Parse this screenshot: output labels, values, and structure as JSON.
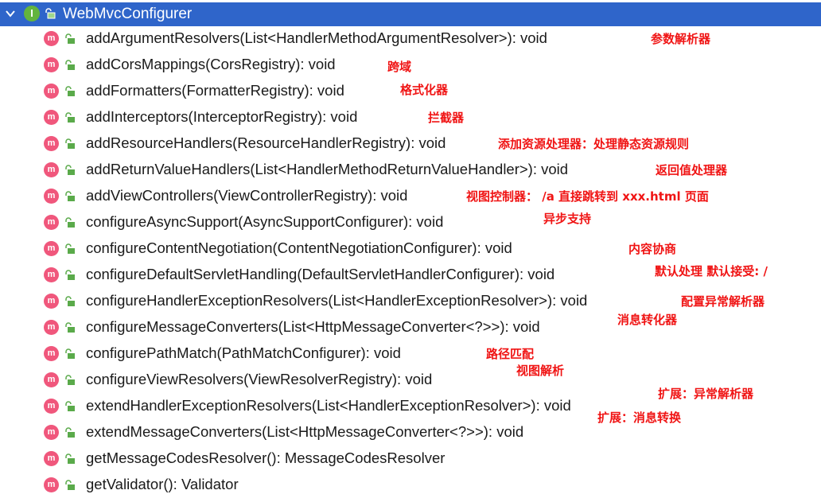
{
  "header": {
    "interface_icon_letter": "I",
    "title": "WebMvcConfigurer"
  },
  "method_icon_letter": "m",
  "methods": [
    {
      "signature": "addArgumentResolvers(List<HandlerMethodArgumentResolver>): void",
      "note": "参数解析器"
    },
    {
      "signature": "addCorsMappings(CorsRegistry): void",
      "note": "跨域"
    },
    {
      "signature": "addFormatters(FormatterRegistry): void",
      "note": "格式化器"
    },
    {
      "signature": "addInterceptors(InterceptorRegistry): void",
      "note": "拦截器"
    },
    {
      "signature": "addResourceHandlers(ResourceHandlerRegistry): void",
      "note": "添加资源处理器：处理静态资源规则"
    },
    {
      "signature": "addReturnValueHandlers(List<HandlerMethodReturnValueHandler>): void",
      "note": "返回值处理器"
    },
    {
      "signature": "addViewControllers(ViewControllerRegistry): void",
      "note": "视图控制器： /a 直接跳转到 xxx.html 页面"
    },
    {
      "signature": "configureAsyncSupport(AsyncSupportConfigurer): void",
      "note": "异步支持"
    },
    {
      "signature": "configureContentNegotiation(ContentNegotiationConfigurer): void",
      "note": "内容协商"
    },
    {
      "signature": "configureDefaultServletHandling(DefaultServletHandlerConfigurer): void",
      "note": "默认处理  默认接受: /"
    },
    {
      "signature": "configureHandlerExceptionResolvers(List<HandlerExceptionResolver>): void",
      "note": "配置异常解析器"
    },
    {
      "signature": "configureMessageConverters(List<HttpMessageConverter<?>>): void",
      "note": "消息转化器"
    },
    {
      "signature": "configurePathMatch(PathMatchConfigurer): void",
      "note": "路径匹配"
    },
    {
      "signature": "configureViewResolvers(ViewResolverRegistry): void",
      "note": "视图解析"
    },
    {
      "signature": "extendHandlerExceptionResolvers(List<HandlerExceptionResolver>): void",
      "note": "扩展：异常解析器"
    },
    {
      "signature": "extendMessageConverters(List<HttpMessageConverter<?>>): void",
      "note": "扩展：消息转换"
    },
    {
      "signature": "getMessageCodesResolver(): MessageCodesResolver",
      "note": ""
    },
    {
      "signature": "getValidator(): Validator",
      "note": ""
    }
  ],
  "colors": {
    "selection_bg": "#2f65ca",
    "interface_icon": "#63b43e",
    "method_icon": "#f0577c",
    "access_icon": "#5aaa4a",
    "annotation_text": "#f01414"
  },
  "icons": {
    "expand": "chevron-down-icon",
    "interface": "interface-icon",
    "method": "method-icon",
    "access": "public-access-icon"
  }
}
